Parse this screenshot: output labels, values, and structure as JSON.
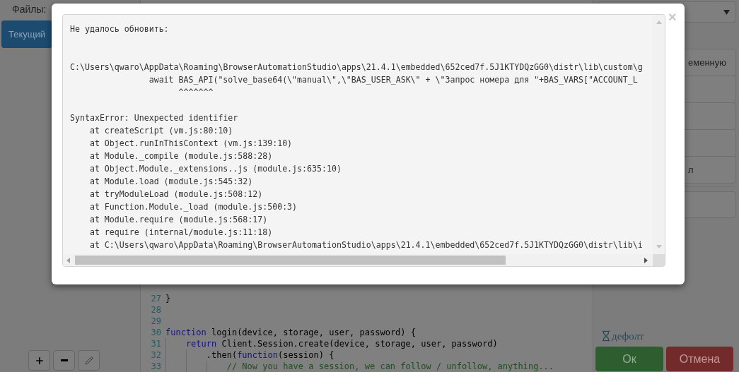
{
  "files_panel": {
    "label": "Файлы:",
    "current_button": "Текущий",
    "tools": [
      {
        "kind": "add"
      },
      {
        "kind": "remove"
      },
      {
        "kind": "edit"
      }
    ]
  },
  "editor": {
    "lines": [
      {
        "number": "27",
        "tokens": [
          {
            "kind": "plain",
            "text": "}"
          }
        ]
      },
      {
        "number": "28"
      },
      {
        "number": "29"
      },
      {
        "number": "30",
        "tokens": [
          {
            "kind": "keyword",
            "text": "function"
          },
          {
            "kind": "plain",
            "text": " login(device, storage, user, password) {"
          }
        ],
        "children": [
          {
            "number": "31",
            "tokens": [
              {
                "kind": "keyword",
                "text": "return"
              },
              {
                "kind": "plain",
                "text": " Client.Session.create(device, storage, user, password)"
              }
            ],
            "children": [
              {
                "number": "32",
                "tokens": [
                  {
                    "kind": "plain",
                    "text": ".then("
                  },
                  {
                    "kind": "keyword",
                    "text": "function"
                  },
                  {
                    "kind": "plain",
                    "text": "(session) {"
                  }
                ],
                "children": [
                  {
                    "number": "33",
                    "tokens": [
                      {
                        "kind": "comment",
                        "text": "// Now you have a session, we can follow / unfollow, anything..."
                      }
                    ]
                  }
                ]
              }
            ]
          }
        ]
      }
    ]
  },
  "side_panel": {
    "buttons": [
      {
        "kind": "labeled",
        "label": "еменную"
      },
      {
        "kind": "blank"
      },
      {
        "kind": "blank"
      },
      {
        "kind": "blank"
      },
      {
        "kind": "labeled",
        "label": "л"
      }
    ],
    "default_label": "дефолт",
    "ok_button": "Ок",
    "cancel_button": "Отмена"
  },
  "dialog": {
    "close": "×",
    "message": "Не удалось обновить:",
    "source": {
      "path": "C:\\Users\\qwaro\\AppData\\Roaming\\BrowserAutomationStudio\\apps\\21.4.1\\embedded\\652ced7f.5J1KTYDQzGG0\\distr\\lib\\custom\\g",
      "code": "await BAS_API(\"solve_base64(\\\"manual\\\",\\\"BAS_USER_ASK\\\" + \\\"Запрос номера для \"+BAS_VARS[\"ACCOUNT_L",
      "caret": "^^^^^^^"
    },
    "error": "SyntaxError: Unexpected identifier",
    "stack": [
      "at createScript (vm.js:80:10)",
      "at Object.runInThisContext (vm.js:139:10)",
      "at Module._compile (module.js:588:28)",
      "at Object.Module._extensions..js (module.js:635:10)",
      "at Module.load (module.js:545:32)",
      "at tryModuleLoad (module.js:508:12)",
      "at Function.Module._load (module.js:500:3)",
      "at Module.require (module.js:568:17)",
      "at require (internal/module.js:11:18)",
      "at C:\\Users\\qwaro\\AppData\\Roaming\\BrowserAutomationStudio\\apps\\21.4.1\\embedded\\652ced7f.5J1KTYDQzGG0\\distr\\lib\\i"
    ]
  }
}
